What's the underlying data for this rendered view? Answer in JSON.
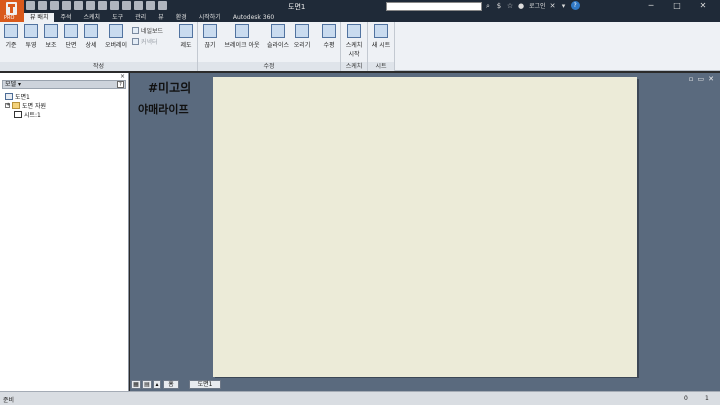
{
  "app": {
    "logo_caption": "PRO"
  },
  "title": {
    "document": "도면1",
    "search_placeholder": "",
    "login": "로그인"
  },
  "tabs": [
    "뷰 배치",
    "주석",
    "스케치",
    "도구",
    "관리",
    "뷰",
    "환경",
    "시작하기",
    "Autodesk 360"
  ],
  "ribbon": {
    "buttons": [
      {
        "label": "기준"
      },
      {
        "label": "투영"
      },
      {
        "label": "보조"
      },
      {
        "label": "단면"
      },
      {
        "label": "상세"
      },
      {
        "label": "오버레이"
      },
      {
        "label": "제도"
      },
      {
        "label": "끊기"
      },
      {
        "label": "브레이크 아웃"
      },
      {
        "label": "슬라이스"
      },
      {
        "label": "오리기"
      },
      {
        "label": "수평"
      },
      {
        "label": "스케치 시작"
      },
      {
        "label": "새 시트"
      }
    ],
    "small": [
      {
        "label": "네일보드"
      },
      {
        "label": "커넥터"
      }
    ],
    "panels": [
      "작성",
      "수정",
      "스케치",
      "시트"
    ]
  },
  "browser": {
    "close": "×",
    "dropdown": "모델 ▾",
    "help": "?",
    "tree": [
      "도면1",
      "도면 자원",
      "시트:1"
    ]
  },
  "canvas": {
    "watermark_line1": "#미고의",
    "watermark_line2": "야매라이프"
  },
  "sheet_tabs": {
    "home": "홈",
    "tab": "도면1"
  },
  "status": {
    "text": "준비",
    "n1": "0",
    "n2": "1"
  },
  "window": {
    "min": "─",
    "max": "□",
    "close": "✕"
  }
}
